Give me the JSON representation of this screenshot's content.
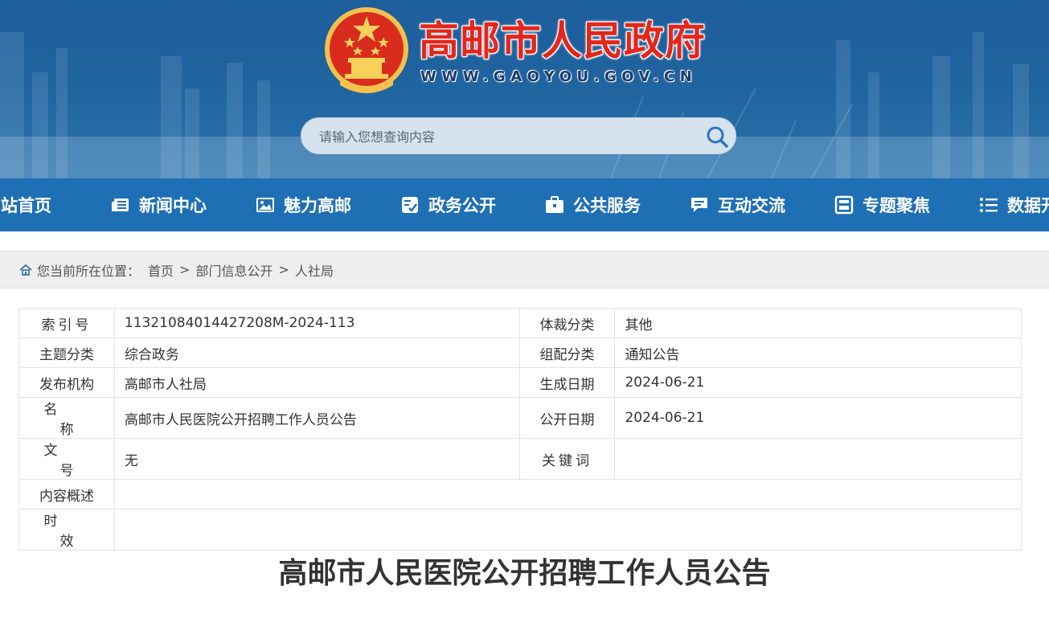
{
  "header": {
    "site_title": "高邮市人民政府",
    "site_url": "WWW.GAOYOU.GOV.CN",
    "search_placeholder": "请输入您想查询内容"
  },
  "nav": {
    "items": [
      {
        "label": "网站首页",
        "icon": "home-icon"
      },
      {
        "label": "新闻中心",
        "icon": "newspaper-icon"
      },
      {
        "label": "魅力高邮",
        "icon": "picture-icon"
      },
      {
        "label": "政务公开",
        "icon": "clipboard-icon"
      },
      {
        "label": "公共服务",
        "icon": "briefcase-icon"
      },
      {
        "label": "互动交流",
        "icon": "chat-icon"
      },
      {
        "label": "专题聚焦",
        "icon": "frame-icon"
      },
      {
        "label": "数据开放",
        "icon": "list-icon"
      }
    ]
  },
  "breadcrumb": {
    "prefix": "您当前所在位置：",
    "items": [
      "首页",
      "部门信息公开",
      "人社局"
    ],
    "separator": ">"
  },
  "info": {
    "index_no_label": "索引号",
    "index_no": "11321084014427208M-2024-113",
    "genre_label": "体裁分类",
    "genre": "其他",
    "topic_label": "主题分类",
    "topic": "综合政务",
    "category_label": "组配分类",
    "category": "通知公告",
    "publisher_label": "发布机构",
    "publisher": "高邮市人社局",
    "created_label": "生成日期",
    "created": "2024-06-21",
    "name_label": "名称",
    "name": "高邮市人民医院公开招聘工作人员公告",
    "published_label": "公开日期",
    "published": "2024-06-21",
    "doc_no_label": "文号",
    "doc_no": "无",
    "keywords_label": "关键词",
    "keywords": "",
    "summary_label": "内容概述",
    "summary": "",
    "validity_label": "时效",
    "validity": ""
  },
  "article": {
    "title": "高邮市人民医院公开招聘工作人员公告"
  },
  "colors": {
    "nav_bg": "#1f6fb5",
    "banner_bg": "#1f639f",
    "title_red": "#e4261b"
  }
}
